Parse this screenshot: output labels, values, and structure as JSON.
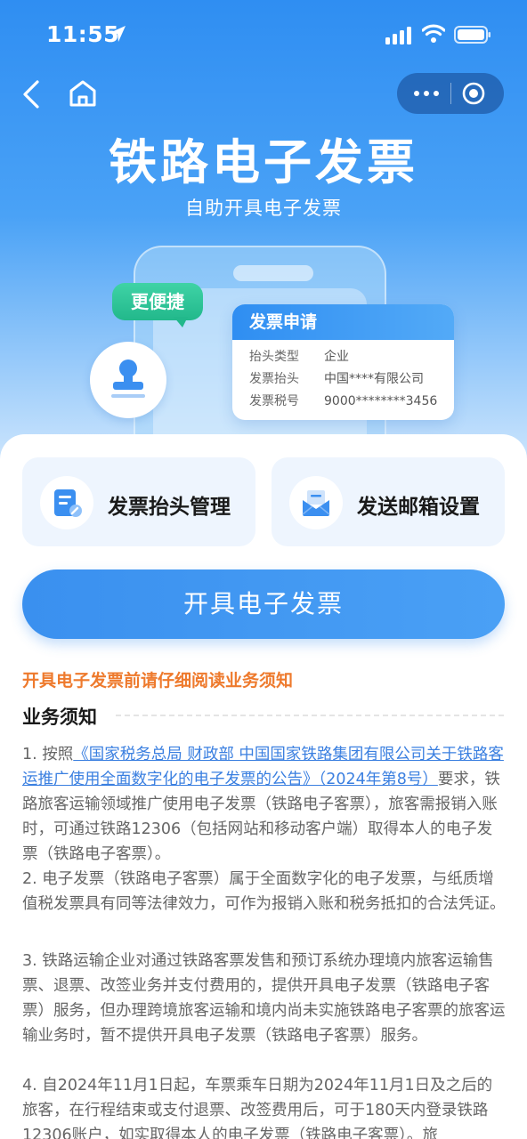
{
  "status": {
    "time": "11:55"
  },
  "hero": {
    "title": "铁路电子发票",
    "subtitle": "自助开具电子发票",
    "badge": "更便捷",
    "invoice_card": {
      "title": "发票申请",
      "rows": [
        {
          "key": "抬头类型",
          "value": "企业"
        },
        {
          "key": "发票抬头",
          "value": "中国****有限公司"
        },
        {
          "key": "发票税号",
          "value": "9000********3456"
        }
      ]
    }
  },
  "actions": {
    "header_mgmt": "发票抬头管理",
    "email_settings": "发送邮箱设置",
    "issue_button": "开具电子发票"
  },
  "notice": {
    "warning": "开具电子发票前请仔细阅读业务须知",
    "title": "业务须知",
    "p1_prefix": "1. 按照",
    "p1_link": "《国家税务总局 财政部 中国国家铁路集团有限公司关于铁路客运推广使用全面数字化的电子发票的公告》（2024年第8号）",
    "p1_suffix": "要求，铁路旅客运输领域推广使用电子发票（铁路电子客票），旅客需报销入账时，可通过铁路12306（包括网站和移动客户端）取得本人的电子发票（铁路电子客票）。",
    "p2": "2. 电子发票（铁路电子客票）属于全面数字化的电子发票，与纸质增值税发票具有同等法律效力，可作为报销入账和税务抵扣的合法凭证。",
    "p3": "3. 铁路运输企业对通过铁路客票发售和预订系统办理境内旅客运输售票、退票、改签业务并支付费用的，提供开具电子发票（铁路电子客票）服务，但办理跨境旅客运输和境内尚未实施铁路电子客票的旅客运输业务时，暂不提供开具电子发票（铁路电子客票）服务。",
    "p4": "4. 自2024年11月1日起，车票乘车日期为2024年11月1日及之后的旅客，在行程结束或支付退票、改签费用后，可于180天内登录铁路12306账户，如实取得本人的电子发票（铁路电子客票）。旅"
  }
}
